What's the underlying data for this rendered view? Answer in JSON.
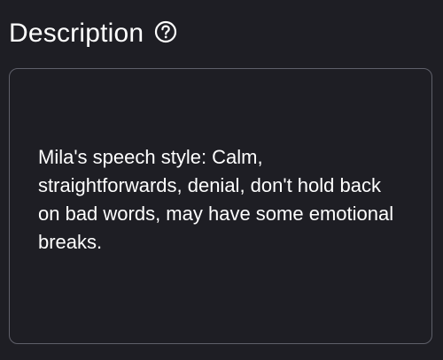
{
  "section": {
    "title": "Description",
    "help_icon": "help-circle-icon"
  },
  "description_field": {
    "value": "Mila's speech style: Calm, straightforwards, denial, don't hold back on bad words, may have some emotional breaks."
  },
  "colors": {
    "background": "#1e1e24",
    "text": "#ffffff",
    "border": "#5f606a"
  }
}
